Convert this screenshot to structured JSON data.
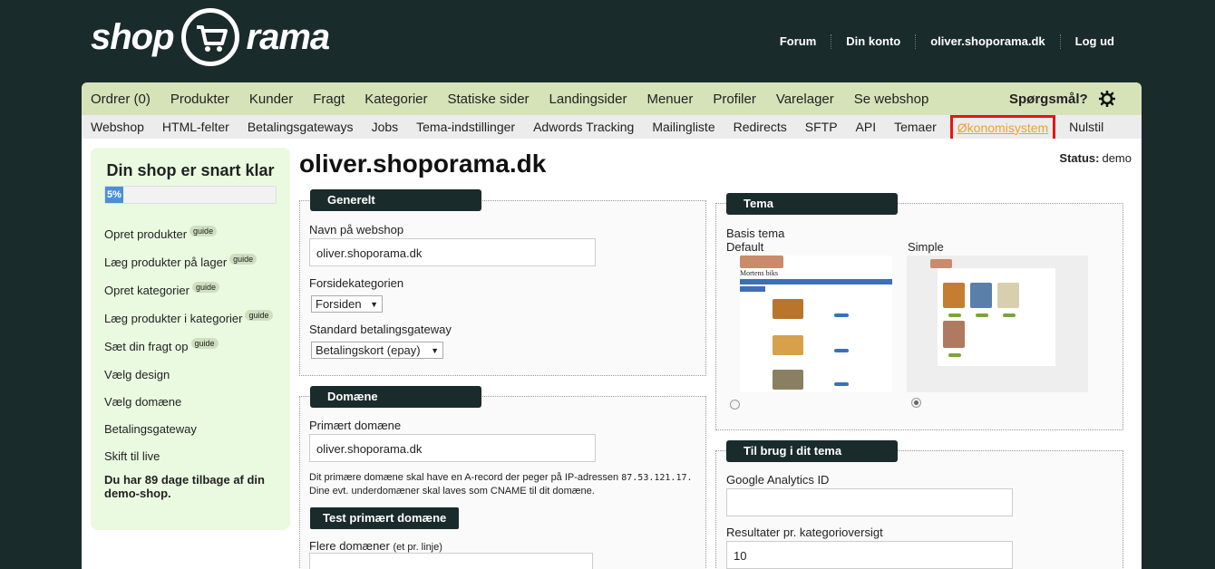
{
  "header": {
    "logo_left": "shop",
    "logo_right": "rama",
    "nav": [
      "Forum",
      "Din konto",
      "oliver.shoporama.dk",
      "Log ud"
    ]
  },
  "mainnav": {
    "items": [
      "Ordrer (0)",
      "Produkter",
      "Kunder",
      "Fragt",
      "Kategorier",
      "Statiske sider",
      "Landingsider",
      "Menuer",
      "Profiler",
      "Varelager",
      "Se webshop"
    ],
    "question": "Spørgsmål?"
  },
  "subnav": {
    "items": [
      "Webshop",
      "HTML-felter",
      "Betalingsgateways",
      "Jobs",
      "Tema-indstillinger",
      "Adwords Tracking",
      "Mailingliste",
      "Redirects",
      "SFTP",
      "API",
      "Temaer",
      "Økonomisystem",
      "Nulstil"
    ]
  },
  "sidebar": {
    "title": "Din shop er snart klar",
    "progress_label": "5%",
    "progress": 0.05,
    "guide_label": "guide",
    "steps": [
      "Opret produkter",
      "Læg produkter på lager",
      "Opret kategorier",
      "Læg produkter i kategorier",
      "Sæt din fragt op",
      "Vælg design",
      "Vælg domæne",
      "Betalingsgateway",
      "Skift til live"
    ],
    "note": "Du har 89 dage tilbage af din demo-shop."
  },
  "page": {
    "title": "oliver.shoporama.dk",
    "status_label": "Status:",
    "status_value": "demo"
  },
  "generelt": {
    "title": "Generelt",
    "name_label": "Navn på webshop",
    "name_value": "oliver.shoporama.dk",
    "frontpage_label": "Forsidekategorien",
    "frontpage_value": "Forsiden",
    "payment_label": "Standard betalingsgateway",
    "payment_value": "Betalingskort (epay)"
  },
  "domaene": {
    "title": "Domæne",
    "primary_label": "Primært domæne",
    "primary_value": "oliver.shoporama.dk",
    "help_text": "Dit primære domæne skal have en A-record der peger på IP-adressen",
    "ip": "87.53.121.17.",
    "help_text2": "Dine evt. underdomæner skal laves som CNAME til dit domæne.",
    "test_button": "Test primært domæne",
    "more_label": "Flere domæner",
    "more_hint": "(et pr. linje)"
  },
  "tema": {
    "title": "Tema",
    "basis_label": "Basis tema",
    "themes": [
      "Default",
      "Simple"
    ],
    "default_shop_name": "Mortens biks",
    "selected": "Simple"
  },
  "brug": {
    "title": "Til brug i dit tema",
    "ga_label": "Google Analytics ID",
    "ga_value": "",
    "results_label": "Resultater pr. kategorioversigt",
    "results_value": "10"
  }
}
